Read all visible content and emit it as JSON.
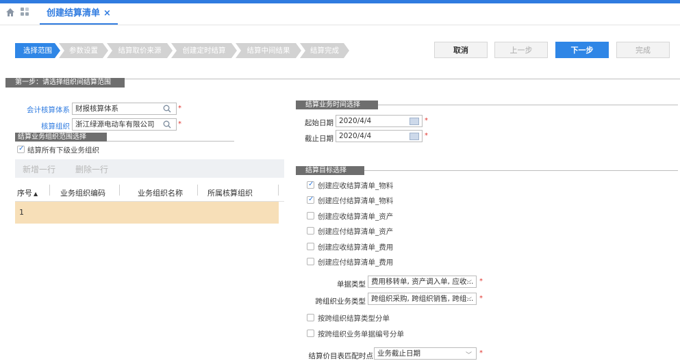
{
  "tab": {
    "title": "创建结算清单",
    "close": "×"
  },
  "steps": [
    "选择范围",
    "参数设置",
    "结算取价来源",
    "创建定时结算",
    "结算中间结果",
    "结算完成"
  ],
  "buttons": {
    "cancel": "取消",
    "prev": "上一步",
    "next": "下一步",
    "finish": "完成"
  },
  "section": {
    "step1": "第一步：请选择组织间结算范围"
  },
  "left": {
    "acct_system_label": "会计核算体系",
    "acct_system_value": "财报核算体系",
    "acct_org_label": "核算组织",
    "acct_org_value": "浙江绿源电动车有限公司",
    "biz_scope_title": "结算业务组织范围选择",
    "settle_all_sub": "结算所有下级业务组织",
    "add_row": "新增一行",
    "del_row": "删除一行",
    "col_seq": "序号",
    "col_seq_sort": "▲",
    "col_biz_code": "业务组织编码",
    "col_biz_name": "业务组织名称",
    "col_acct_org": "所属核算组织",
    "row1_seq": "1"
  },
  "right": {
    "time_title": "结算业务时间选择",
    "start_label": "起始日期",
    "start_value": "2020/4/4",
    "end_label": "截止日期",
    "end_value": "2020/4/4",
    "target_title": "结算目标选择",
    "targets": [
      {
        "label": "创建应收结算清单_物料",
        "checked": true
      },
      {
        "label": "创建应付结算清单_物料",
        "checked": true
      },
      {
        "label": "创建应收结算清单_资产",
        "checked": false
      },
      {
        "label": "创建应付结算清单_资产",
        "checked": false
      },
      {
        "label": "创建应收结算清单_费用",
        "checked": false
      },
      {
        "label": "创建应付结算清单_费用",
        "checked": false
      }
    ],
    "doc_type_label": "单据类型",
    "doc_type_value": "费用移转单, 资产调入单, 应收...",
    "cross_biz_label": "跨组织业务类型",
    "cross_biz_value": "跨组织采购, 跨组织销售, 跨组...",
    "split_by_type": "按跨组织结算类型分单",
    "split_by_bizno": "按跨组织业务单据编号分单",
    "price_match_label": "结算价目表匹配时点",
    "price_match_value": "业务截止日期"
  },
  "required_mark": "*",
  "colors": {
    "accent": "#2f7be0",
    "primary_button": "#2f86e6",
    "row_highlight": "#f7dfb8"
  }
}
